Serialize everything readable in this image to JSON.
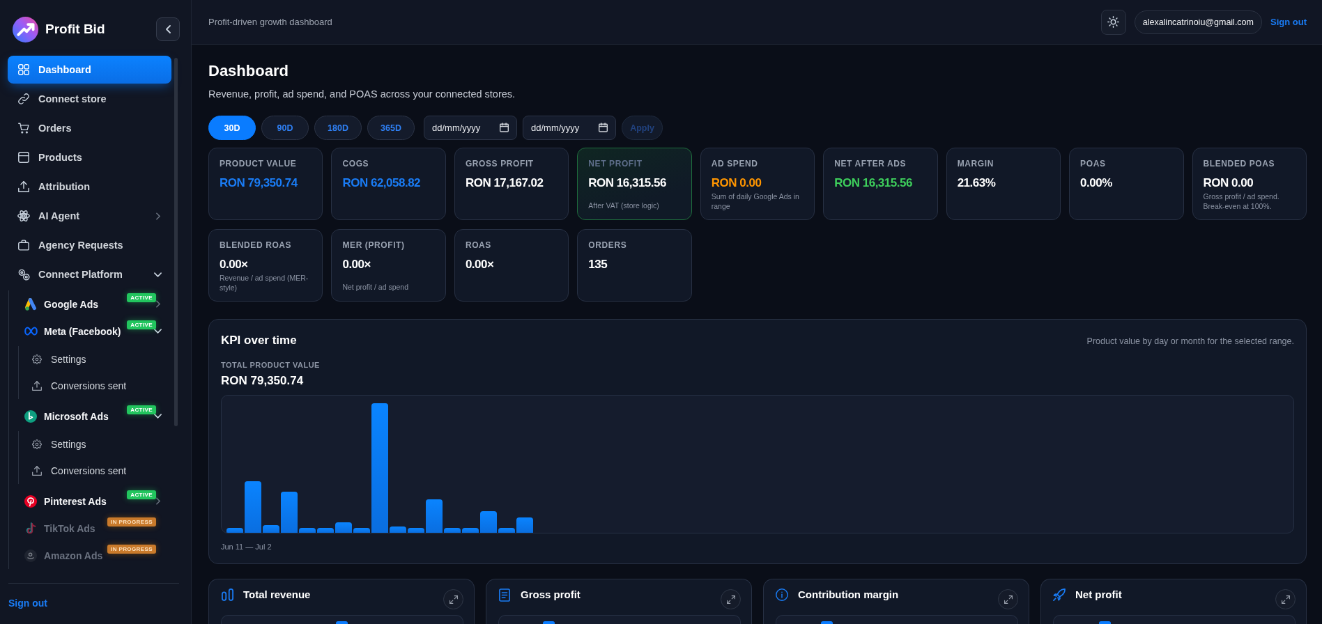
{
  "sidebar": {
    "brand": "Profit Bid",
    "nav": [
      {
        "label": "Dashboard",
        "selected": true
      },
      {
        "label": "Connect store",
        "selected": false
      },
      {
        "label": "Orders",
        "selected": false
      },
      {
        "label": "Products",
        "selected": false
      },
      {
        "label": "Attribution",
        "selected": false
      },
      {
        "label": "AI Agent",
        "selected": false,
        "expanded": false
      },
      {
        "label": "Agency Requests",
        "selected": false
      },
      {
        "label": "Connect Platform",
        "selected": false,
        "expanded": true,
        "children": [
          {
            "label": "Google Ads",
            "selected": false,
            "disabled": false,
            "badge": {
              "label": "ACTIVE",
              "kind": "active"
            },
            "expanded": false
          },
          {
            "label": "Meta (Facebook)",
            "selected": false,
            "disabled": false,
            "badge": {
              "label": "ACTIVE",
              "kind": "active"
            },
            "expanded": true,
            "children": [
              {
                "label": "Settings",
                "selected": false
              },
              {
                "label": "Conversions sent",
                "selected": false
              }
            ]
          },
          {
            "label": "Microsoft Ads",
            "selected": false,
            "disabled": false,
            "badge": {
              "label": "ACTIVE",
              "kind": "active"
            },
            "expanded": true,
            "children": [
              {
                "label": "Settings",
                "selected": false
              },
              {
                "label": "Conversions sent",
                "selected": false
              }
            ]
          },
          {
            "label": "Pinterest Ads",
            "selected": false,
            "disabled": false,
            "badge": {
              "label": "ACTIVE",
              "kind": "active"
            },
            "expanded": false
          },
          {
            "label": "TikTok Ads",
            "selected": false,
            "disabled": true,
            "badge": {
              "label": "IN PROGRESS",
              "kind": "in_progress"
            }
          },
          {
            "label": "Amazon Ads",
            "selected": false,
            "disabled": true,
            "badge": {
              "label": "IN PROGRESS",
              "kind": "in_progress"
            }
          }
        ]
      }
    ],
    "sign_out": "Sign out"
  },
  "header": {
    "tagline": "Profit-driven growth dashboard",
    "email": "alexalincatrinoiu@gmail.com",
    "sign_out": "Sign out"
  },
  "page": {
    "title": "Dashboard",
    "description": "Revenue, profit, ad spend, and POAS across your connected stores."
  },
  "filters": {
    "ranges": [
      {
        "label": "30D",
        "selected": true
      },
      {
        "label": "90D",
        "selected": false
      },
      {
        "label": "180D",
        "selected": false
      },
      {
        "label": "365D",
        "selected": false
      }
    ],
    "date_fields": [
      {
        "placeholder": "dd/mm/yyyy"
      },
      {
        "placeholder": "dd/mm/yyyy"
      }
    ],
    "apply": {
      "label": "Apply",
      "disabled": true
    }
  },
  "kpi_cards": [
    {
      "label": "PRODUCT VALUE",
      "value": "RON 79,350.74",
      "color": "#1a7cf5",
      "highlighted": false
    },
    {
      "label": "COGS",
      "value": "RON 62,058.82",
      "color": "#1a7cf5",
      "highlighted": false
    },
    {
      "label": "GROSS PROFIT",
      "value": "RON 17,167.02",
      "color": "#ffffff",
      "highlighted": false
    },
    {
      "label": "NET PROFIT",
      "value": "RON 16,315.56",
      "note": "After VAT (store logic)",
      "color": "#ffffff",
      "highlighted": true
    },
    {
      "label": "AD SPEND",
      "value": "RON 0.00",
      "note": "Sum of daily Google Ads in range",
      "color": "#ff9500",
      "highlighted": false
    },
    {
      "label": "NET AFTER ADS",
      "value": "RON 16,315.56",
      "color": "#3ecf5c",
      "highlighted": false
    },
    {
      "label": "MARGIN",
      "value": "21.63%",
      "color": "#ffffff",
      "highlighted": false
    },
    {
      "label": "POAS",
      "value": "0.00%",
      "color": "#ffffff",
      "highlighted": false
    },
    {
      "label": "BLENDED POAS",
      "value": "RON 0.00",
      "note": "Gross profit / ad spend. Break-even at 100%.",
      "color": "#ffffff",
      "highlighted": false
    },
    {
      "label": "BLENDED ROAS",
      "value": "0.00×",
      "note": "Revenue / ad spend (MER-style)",
      "color": "#ffffff",
      "highlighted": false
    },
    {
      "label": "MER (PROFIT)",
      "value": "0.00×",
      "note": "Net profit / ad spend",
      "color": "#ffffff",
      "highlighted": false
    },
    {
      "label": "ROAS",
      "value": "0.00×",
      "color": "#ffffff",
      "highlighted": false
    },
    {
      "label": "ORDERS",
      "value": "135",
      "color": "#ffffff",
      "highlighted": false
    }
  ],
  "kpi_chart": {
    "title": "KPI over time",
    "description": "Product value by day or month for the selected range.",
    "metric_label": "TOTAL PRODUCT VALUE",
    "metric_value": "RON 79,350.74",
    "range": "Jun 11 — Jul 2"
  },
  "metric_cards": [
    {
      "title": "Total revenue"
    },
    {
      "title": "Gross profit"
    },
    {
      "title": "Contribution margin"
    },
    {
      "title": "Net profit"
    }
  ]
}
